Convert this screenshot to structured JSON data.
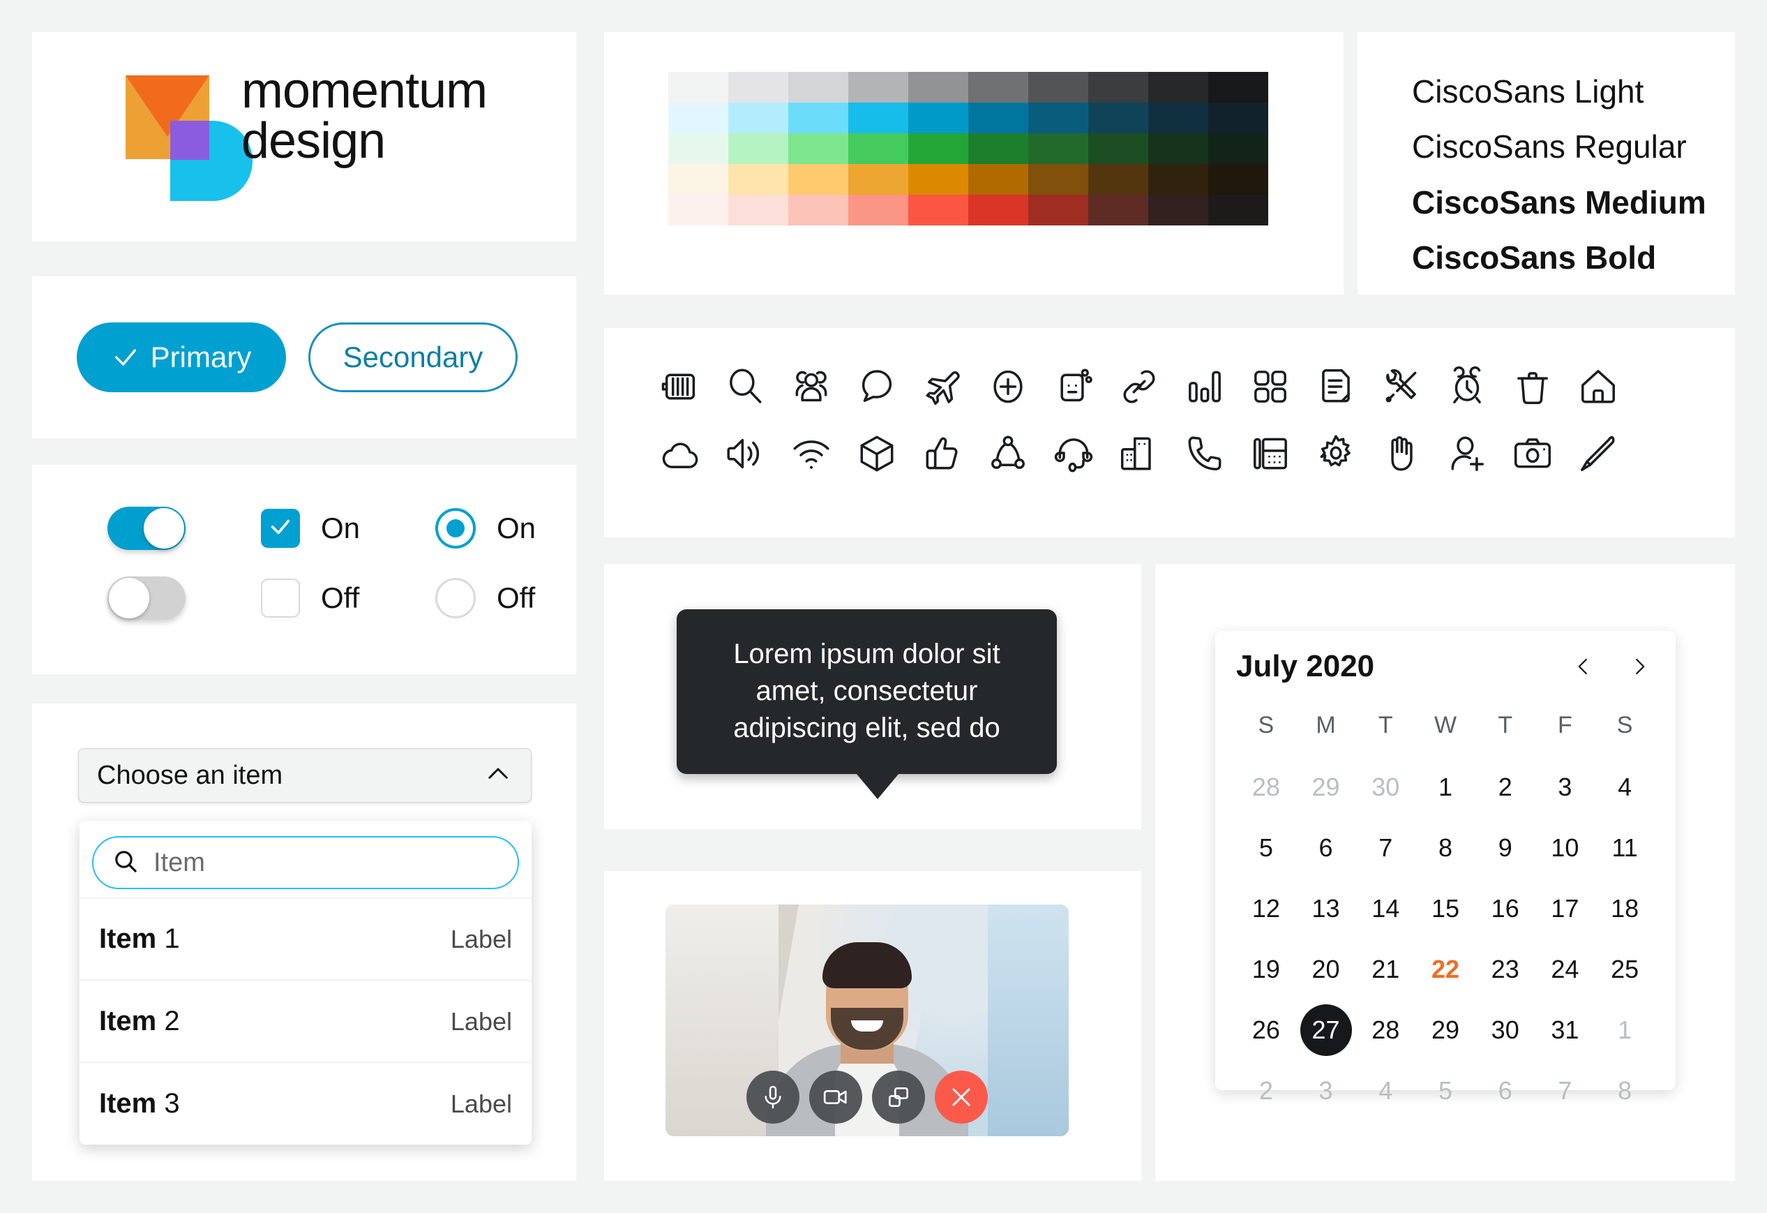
{
  "logo": {
    "line1": "momentum",
    "line2": "design",
    "colors": {
      "orange": "#eda135",
      "orange_dark": "#f26b1d",
      "blue": "#18c0ec",
      "purple": "#8a5de0"
    }
  },
  "buttons": {
    "primary_label": "Primary",
    "secondary_label": "Secondary",
    "primary_color": "#00A0D1",
    "secondary_border": "#1a8fbd"
  },
  "controls": {
    "accent": "#00A0D1",
    "rows": [
      {
        "switch_state": "on",
        "checkbox_state": "checked",
        "checkbox_label": "On",
        "radio_state": "on",
        "radio_label": "On"
      },
      {
        "switch_state": "off",
        "checkbox_state": "unchecked",
        "checkbox_label": "Off",
        "radio_state": "off",
        "radio_label": "Off"
      }
    ]
  },
  "dropdown": {
    "select_label": "Choose an item",
    "chevron": "chevron-up-icon",
    "search_placeholder": "Item",
    "items": [
      {
        "title": "Item",
        "number": "1",
        "label": "Label"
      },
      {
        "title": "Item",
        "number": "2",
        "label": "Label"
      },
      {
        "title": "Item",
        "number": "3",
        "label": "Label"
      }
    ]
  },
  "palette": {
    "rows": [
      {
        "name": "gray",
        "swatches": [
          "#f2f3f3",
          "#e4e4e6",
          "#d4d5d7",
          "#b3b4b6",
          "#919394",
          "#707172",
          "#535455",
          "#3c3d3f",
          "#27282a",
          "#17191b"
        ]
      },
      {
        "name": "blue",
        "swatches": [
          "#e1f7fd",
          "#b3edfc",
          "#6cdcfb",
          "#17bdea",
          "#009ac9",
          "#00769f",
          "#0a5c7d",
          "#0f4458",
          "#11303f",
          "#12222b"
        ]
      },
      {
        "name": "green",
        "swatches": [
          "#e6f8ec",
          "#b6f3c2",
          "#7de68f",
          "#45cb5d",
          "#23a636",
          "#1c7f2b",
          "#226a2b",
          "#1c4d23",
          "#16331b",
          "#122417"
        ]
      },
      {
        "name": "orange",
        "swatches": [
          "#fcf5e6",
          "#ffe5ab",
          "#ffc96d",
          "#eda632",
          "#db8a00",
          "#b06a00",
          "#81500b",
          "#53360e",
          "#31220d",
          "#1f180b"
        ]
      },
      {
        "name": "red",
        "swatches": [
          "#fdf1ee",
          "#fcdfd8",
          "#fcc3b8",
          "#fb9585",
          "#fb5641",
          "#da3526",
          "#9f2d22",
          "#5e2b25",
          "#33211f",
          "#1d1a1a"
        ]
      }
    ]
  },
  "typography": {
    "lines": [
      {
        "text": "CiscoSans Light",
        "weight": "light"
      },
      {
        "text": "CiscoSans Regular",
        "weight": "regular"
      },
      {
        "text": "CiscoSans Medium",
        "weight": "medium"
      },
      {
        "text": "CiscoSans Bold",
        "weight": "bold"
      }
    ]
  },
  "icons": {
    "row1": [
      "briefcase-icon",
      "search-icon",
      "people-group-icon",
      "chat-bubble-icon",
      "airplane-icon",
      "plus-circle-icon",
      "device-robot-icon",
      "link-icon",
      "bar-chart-icon",
      "grid-apps-icon",
      "document-icon",
      "tools-icon",
      "alarm-clock-icon",
      "trash-icon",
      "home-icon"
    ],
    "row2": [
      "cloud-icon",
      "volume-icon",
      "wifi-icon",
      "cube-icon",
      "thumbs-up-icon",
      "share-network-icon",
      "headset-icon",
      "building-icon",
      "phone-handset-icon",
      "desk-phone-icon",
      "gear-icon",
      "raise-hand-icon",
      "add-person-icon",
      "camera-icon",
      "pencil-icon"
    ]
  },
  "tooltip": {
    "text": "Lorem ipsum dolor sit amet, consectetur adipiscing elit, sed do",
    "background": "#25282a"
  },
  "video": {
    "controls": [
      {
        "name": "microphone-button",
        "icon": "microphone-icon",
        "style": "grey"
      },
      {
        "name": "camera-button",
        "icon": "video-camera-icon",
        "style": "grey"
      },
      {
        "name": "share-screen-button",
        "icon": "share-screen-icon",
        "style": "grey"
      },
      {
        "name": "end-call-button",
        "icon": "close-icon",
        "style": "red"
      }
    ],
    "end_call_color": "#fb5a4b"
  },
  "calendar": {
    "title": "July 2020",
    "prev": "chevron-left-icon",
    "next": "chevron-right-icon",
    "day_headers": [
      "S",
      "M",
      "T",
      "W",
      "T",
      "F",
      "S"
    ],
    "today_color": "#f26d21",
    "selected_color": "#16191b",
    "weeks": [
      [
        {
          "d": "28",
          "s": "muted"
        },
        {
          "d": "29",
          "s": "muted"
        },
        {
          "d": "30",
          "s": "muted"
        },
        {
          "d": "1",
          "s": ""
        },
        {
          "d": "2",
          "s": ""
        },
        {
          "d": "3",
          "s": ""
        },
        {
          "d": "4",
          "s": ""
        }
      ],
      [
        {
          "d": "5",
          "s": ""
        },
        {
          "d": "6",
          "s": ""
        },
        {
          "d": "7",
          "s": ""
        },
        {
          "d": "8",
          "s": ""
        },
        {
          "d": "9",
          "s": ""
        },
        {
          "d": "10",
          "s": ""
        },
        {
          "d": "11",
          "s": ""
        }
      ],
      [
        {
          "d": "12",
          "s": ""
        },
        {
          "d": "13",
          "s": ""
        },
        {
          "d": "14",
          "s": ""
        },
        {
          "d": "15",
          "s": ""
        },
        {
          "d": "16",
          "s": ""
        },
        {
          "d": "17",
          "s": ""
        },
        {
          "d": "18",
          "s": ""
        }
      ],
      [
        {
          "d": "19",
          "s": ""
        },
        {
          "d": "20",
          "s": ""
        },
        {
          "d": "21",
          "s": ""
        },
        {
          "d": "22",
          "s": "today"
        },
        {
          "d": "23",
          "s": ""
        },
        {
          "d": "24",
          "s": ""
        },
        {
          "d": "25",
          "s": ""
        }
      ],
      [
        {
          "d": "26",
          "s": ""
        },
        {
          "d": "27",
          "s": "selected"
        },
        {
          "d": "28",
          "s": ""
        },
        {
          "d": "29",
          "s": ""
        },
        {
          "d": "30",
          "s": ""
        },
        {
          "d": "31",
          "s": ""
        },
        {
          "d": "1",
          "s": "muted"
        }
      ],
      [
        {
          "d": "2",
          "s": "muted"
        },
        {
          "d": "3",
          "s": "muted"
        },
        {
          "d": "4",
          "s": "muted"
        },
        {
          "d": "5",
          "s": "muted"
        },
        {
          "d": "6",
          "s": "muted"
        },
        {
          "d": "7",
          "s": "muted"
        },
        {
          "d": "8",
          "s": "muted"
        }
      ]
    ]
  }
}
